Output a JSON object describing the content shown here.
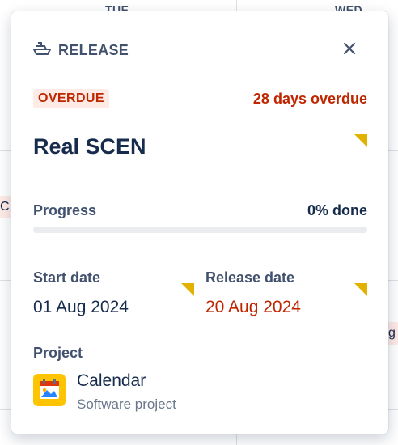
{
  "background": {
    "day_headers": [
      "TUE",
      "WED"
    ],
    "chip_left": "C",
    "chip_right": "g"
  },
  "popup": {
    "header_icon": "ship-icon",
    "header_title": "RELEASE",
    "close_icon": "close-icon",
    "status_badge": "OVERDUE",
    "overdue_text": "28 days overdue",
    "release_name": "Real SCEN",
    "progress": {
      "label": "Progress",
      "value_text": "0% done",
      "fraction": 0
    },
    "start_date": {
      "label": "Start date",
      "value": "01 Aug 2024"
    },
    "release_date": {
      "label": "Release date",
      "value": "20 Aug 2024"
    },
    "project": {
      "label": "Project",
      "icon": "calendar-project-icon",
      "name": "Calendar",
      "type": "Software project"
    },
    "colors": {
      "overdue_red": "#bf2600",
      "badge_bg": "#ffebe6",
      "flag_yellow": "#e2b203",
      "project_icon_bg": "#ffc400"
    }
  }
}
